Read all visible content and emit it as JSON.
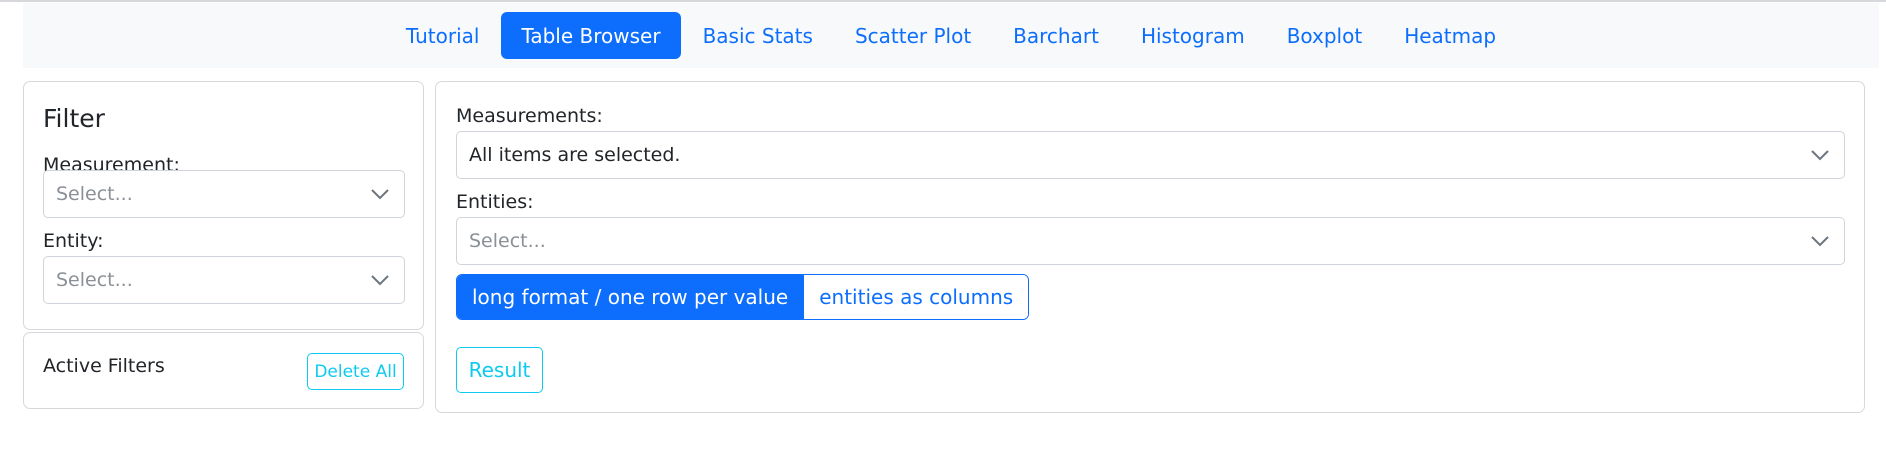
{
  "nav": {
    "tabs": [
      {
        "label": "Tutorial",
        "active": false
      },
      {
        "label": "Table Browser",
        "active": true
      },
      {
        "label": "Basic Stats",
        "active": false
      },
      {
        "label": "Scatter Plot",
        "active": false
      },
      {
        "label": "Barchart",
        "active": false
      },
      {
        "label": "Histogram",
        "active": false
      },
      {
        "label": "Boxplot",
        "active": false
      },
      {
        "label": "Heatmap",
        "active": false
      }
    ]
  },
  "filter": {
    "title": "Filter",
    "measurement_label": "Measurement:",
    "measurement_placeholder": "Select...",
    "entity_label": "Entity:",
    "entity_placeholder": "Select..."
  },
  "active_filters": {
    "title": "Active Filters",
    "delete_all_label": "Delete All"
  },
  "main": {
    "measurements_label": "Measurements:",
    "measurements_value": "All items are selected.",
    "entities_label": "Entities:",
    "entities_placeholder": "Select...",
    "format_options": [
      {
        "label": "long format / one row per value",
        "selected": true
      },
      {
        "label": "entities as columns",
        "selected": false
      }
    ],
    "result_label": "Result"
  },
  "colors": {
    "primary": "#0d6efd",
    "info": "#0dcaf0",
    "nav_bg": "#f8f9fa",
    "border": "#d6d8db"
  },
  "icons": {
    "dropdown": "chevron-down-icon"
  }
}
